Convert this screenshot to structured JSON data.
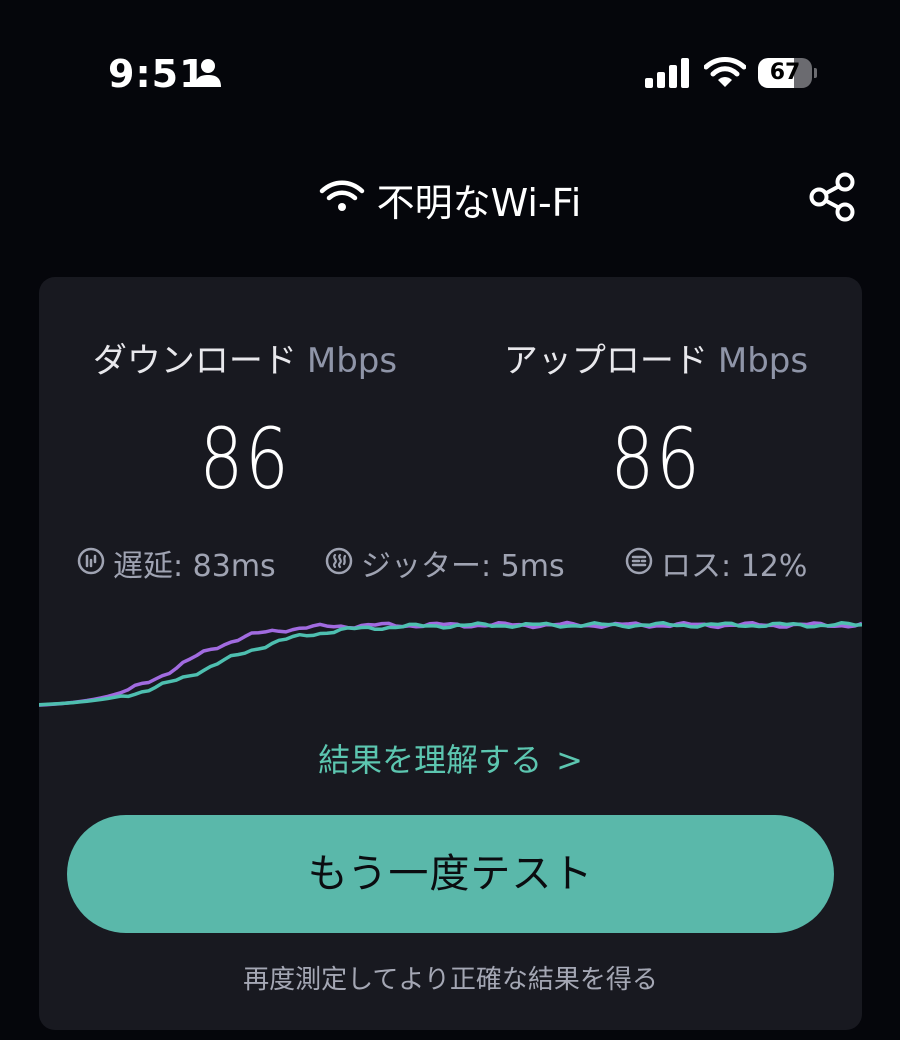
{
  "status_bar": {
    "time": "9:51",
    "battery_level": "67",
    "battery_fraction": 0.67,
    "icons": [
      "person-icon",
      "signal-icon",
      "wifi-icon",
      "battery-icon"
    ]
  },
  "header": {
    "network_name": "不明なWi-Fi",
    "icons": [
      "wifi-icon",
      "share-icon"
    ]
  },
  "results": {
    "download": {
      "label": "ダウンロード",
      "unit": "Mbps",
      "value": "86"
    },
    "upload": {
      "label": "アップロード",
      "unit": "Mbps",
      "value": "86"
    },
    "latency": "遅延: 83ms",
    "jitter": "ジッター: 5ms",
    "loss": "ロス: 12%"
  },
  "speed_graph": {
    "colors": {
      "download": "#a16be0",
      "upload": "#4ebfb0"
    }
  },
  "actions": {
    "understand_link": "結果を理解する",
    "understand_chevron": ">",
    "retest_button": "もう一度テスト",
    "hint": "再度測定してより正確な結果を得る"
  },
  "colors": {
    "background": "#05060b",
    "card": "#181920",
    "accent": "#5ab8aa",
    "link": "#5cc6b0"
  }
}
